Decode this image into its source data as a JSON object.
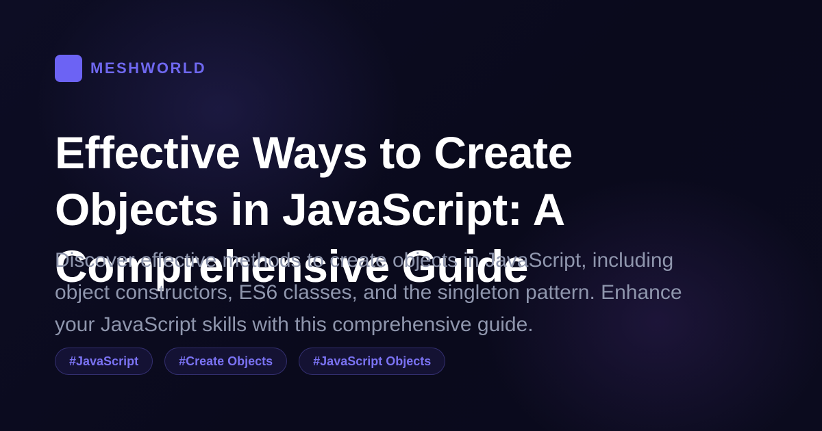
{
  "brand": {
    "name": "MESHWORLD",
    "logo_color": "#6c63f4"
  },
  "title": "Effective Ways to Create Objects in JavaScript: A Comprehensive Guide",
  "description": "Discover effective methods to create objects in JavaScript, including object constructors, ES6 classes, and the singleton pattern. Enhance your JavaScript skills with this comprehensive guide.",
  "tags": [
    "#JavaScript",
    "#Create Objects",
    "#JavaScript Objects"
  ],
  "colors": {
    "background": "#0b0b1e",
    "accent": "#6f68f0",
    "title": "#ffffff",
    "description": "#8f96ad"
  }
}
